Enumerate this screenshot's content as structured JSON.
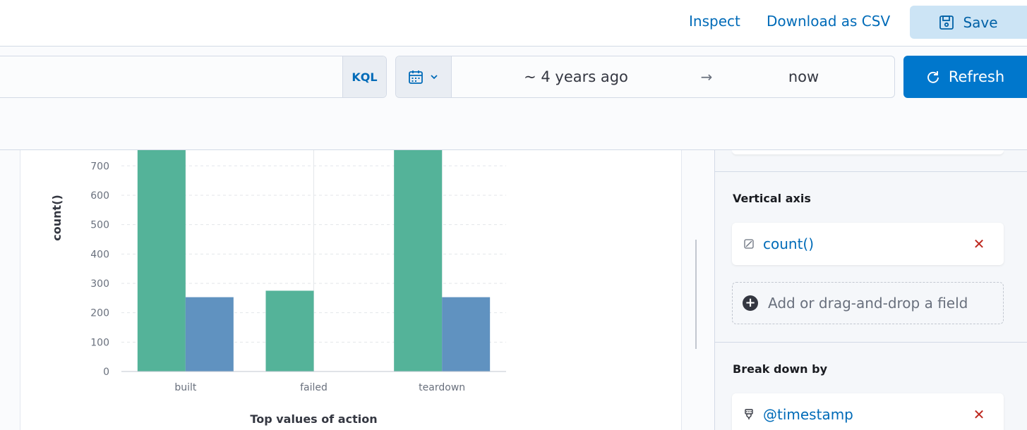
{
  "header": {
    "inspect_label": "Inspect",
    "download_label": "Download as CSV",
    "save_label": "Save"
  },
  "query": {
    "language_label": "KQL",
    "date_start": "~ 4 years ago",
    "date_end": "now",
    "arrow": "→",
    "refresh_label": "Refresh"
  },
  "config": {
    "vertical_axis_title": "Vertical axis",
    "vertical_axis_field": "count()",
    "add_field_label": "Add or drag-and-drop a field",
    "breakdown_title": "Break down by",
    "breakdown_field": "@timestamp",
    "remove_glyph": "✕"
  },
  "colors": {
    "series_1": "#54b399",
    "series_2": "#6092c0",
    "accent": "#0077cc"
  },
  "chart_data": {
    "type": "bar",
    "categories": [
      "built",
      "failed",
      "teardown"
    ],
    "series": [
      {
        "values": [
          760,
          275,
          760
        ]
      },
      {
        "values": [
          253,
          0,
          253
        ]
      }
    ],
    "xlabel": "Top values of action",
    "ylabel": "count()",
    "ylim": [
      0,
      700
    ],
    "yticks": [
      0,
      100,
      200,
      300,
      400,
      500,
      600,
      700
    ],
    "grid": true
  }
}
